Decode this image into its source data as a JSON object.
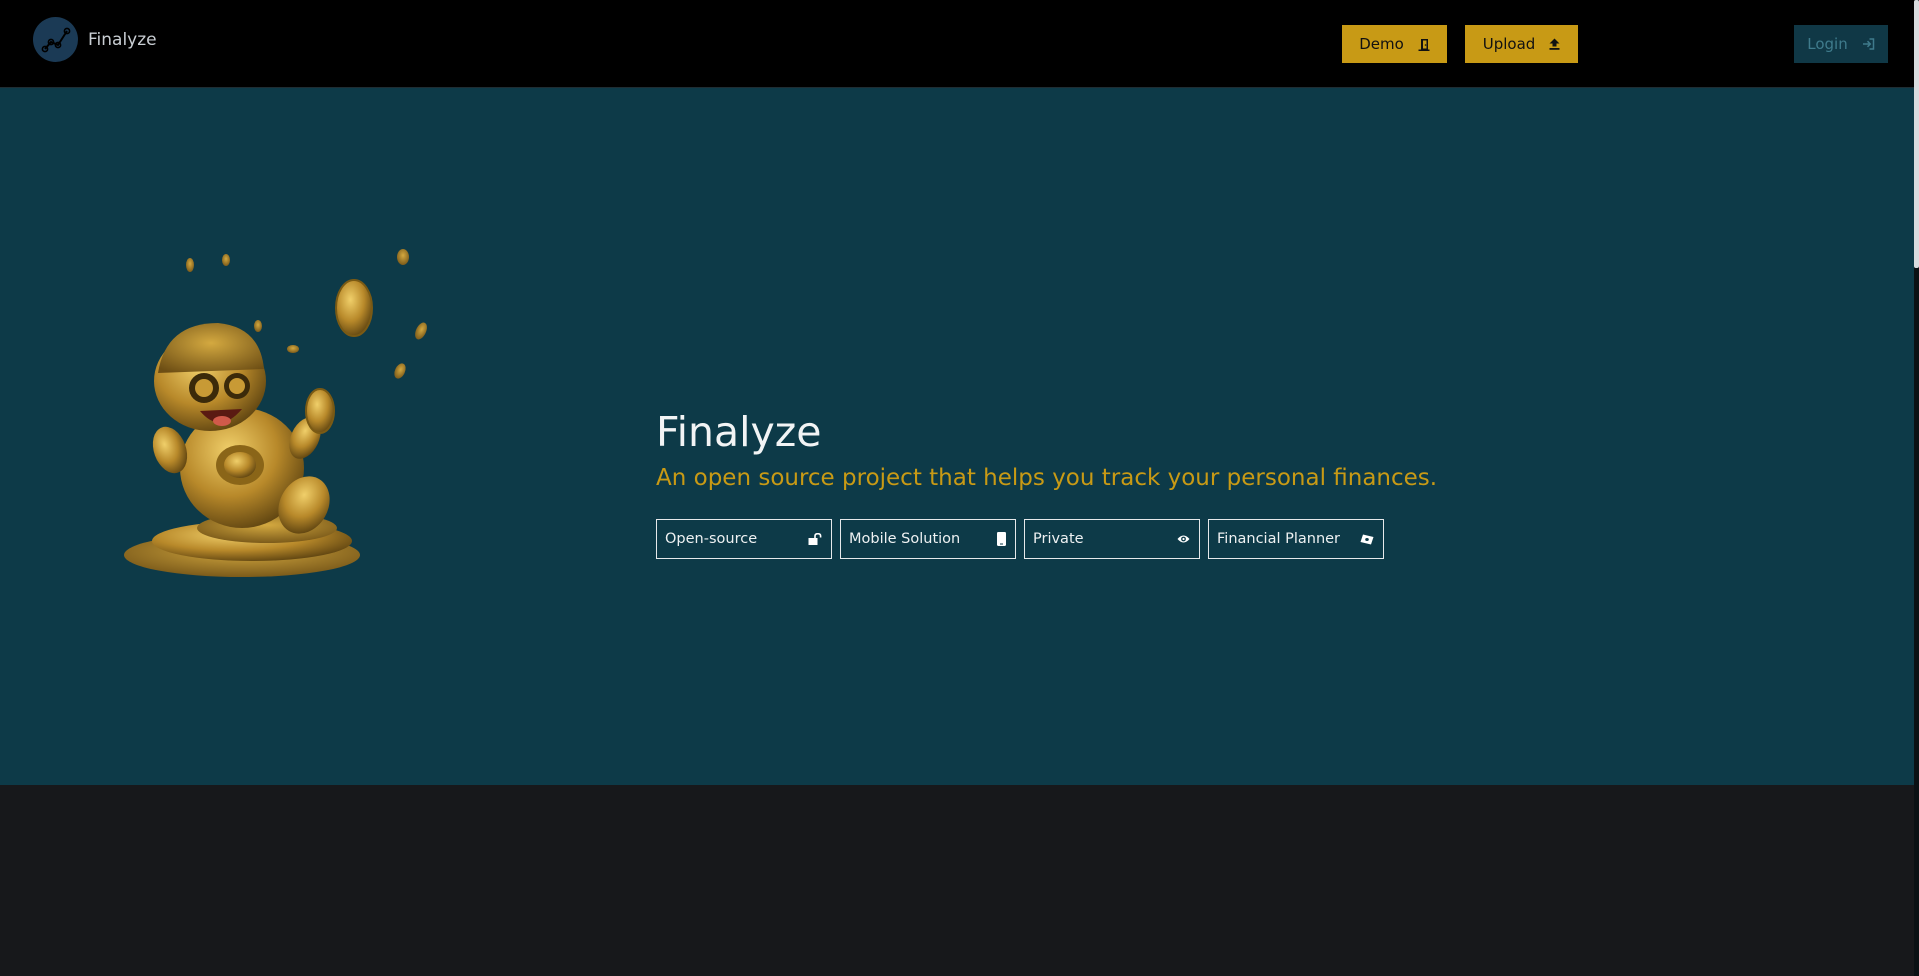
{
  "navbar": {
    "brand_name": "Finalyze",
    "demo_label": "Demo",
    "upload_label": "Upload",
    "login_label": "Login"
  },
  "hero": {
    "title": "Finalyze",
    "subtitle": "An open source project that helps you track your personal finances.",
    "features": [
      {
        "label": "Open-source",
        "icon": "unlock-icon"
      },
      {
        "label": "Mobile Solution",
        "icon": "mobile-icon"
      },
      {
        "label": "Private",
        "icon": "eye-icon"
      },
      {
        "label": "Financial Planner",
        "icon": "money-bill-icon"
      }
    ]
  },
  "colors": {
    "navbar_bg": "#000000",
    "hero_bg": "#0d3a48",
    "accent": "#c89a15",
    "footer_bg": "#17181b"
  }
}
